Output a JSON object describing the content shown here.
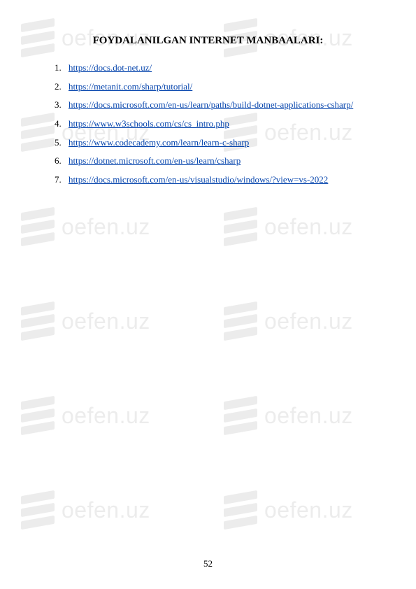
{
  "title": "FOYDALANILGAN INTERNET MANBAALARI:",
  "links": [
    {
      "num": "1.",
      "text": "https://docs.dot-net.uz/"
    },
    {
      "num": "2.",
      "text": "https://metanit.com/sharp/tutorial/"
    },
    {
      "num": "3.",
      "text": "https://docs.microsoft.com/en-us/learn/paths/build-dotnet-applications-csharp/"
    },
    {
      "num": "4.",
      "text": "https://www.w3schools.com/cs/cs_intro.php"
    },
    {
      "num": "5.",
      "text": "https://www.codecademy.com/learn/learn-c-sharp"
    },
    {
      "num": "6.",
      "text": "https://dotnet.microsoft.com/en-us/learn/csharp"
    },
    {
      "num": "7.",
      "text": "https://docs.microsoft.com/en-us/visualstudio/windows/?view=vs-2022"
    }
  ],
  "page_number": "52",
  "watermark_text": "oefen.uz"
}
